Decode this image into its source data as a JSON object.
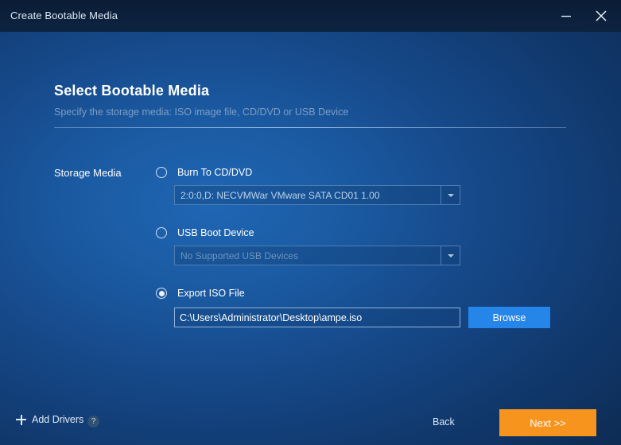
{
  "window": {
    "title": "Create Bootable Media",
    "minimize_icon": "minimize-icon",
    "close_icon": "close-icon"
  },
  "header": {
    "heading": "Select Bootable Media",
    "subheading": "Specify the storage media: ISO image file, CD/DVD or USB Device"
  },
  "form": {
    "section_label": "Storage Media",
    "options": [
      {
        "id": "burn-cd-dvd",
        "label": "Burn To CD/DVD",
        "selected": false,
        "dropdown_value": "2:0:0,D: NECVMWar VMware SATA CD01 1.00",
        "dropdown_disabled": false
      },
      {
        "id": "usb-boot-device",
        "label": "USB Boot Device",
        "selected": false,
        "dropdown_value": "No Supported USB Devices",
        "dropdown_disabled": true
      },
      {
        "id": "export-iso-file",
        "label": "Export ISO File",
        "selected": true,
        "path_value": "C:\\Users\\Administrator\\Desktop\\ampe.iso"
      }
    ],
    "browse_label": "Browse"
  },
  "footer": {
    "add_drivers_label": "Add Drivers",
    "help_label": "?",
    "back_label": "Back",
    "next_label": "Next >>"
  },
  "colors": {
    "accent_orange": "#f7941e",
    "accent_blue": "#2585e8",
    "background_dark": "#0a1c36",
    "background_light": "#1f66b4"
  }
}
